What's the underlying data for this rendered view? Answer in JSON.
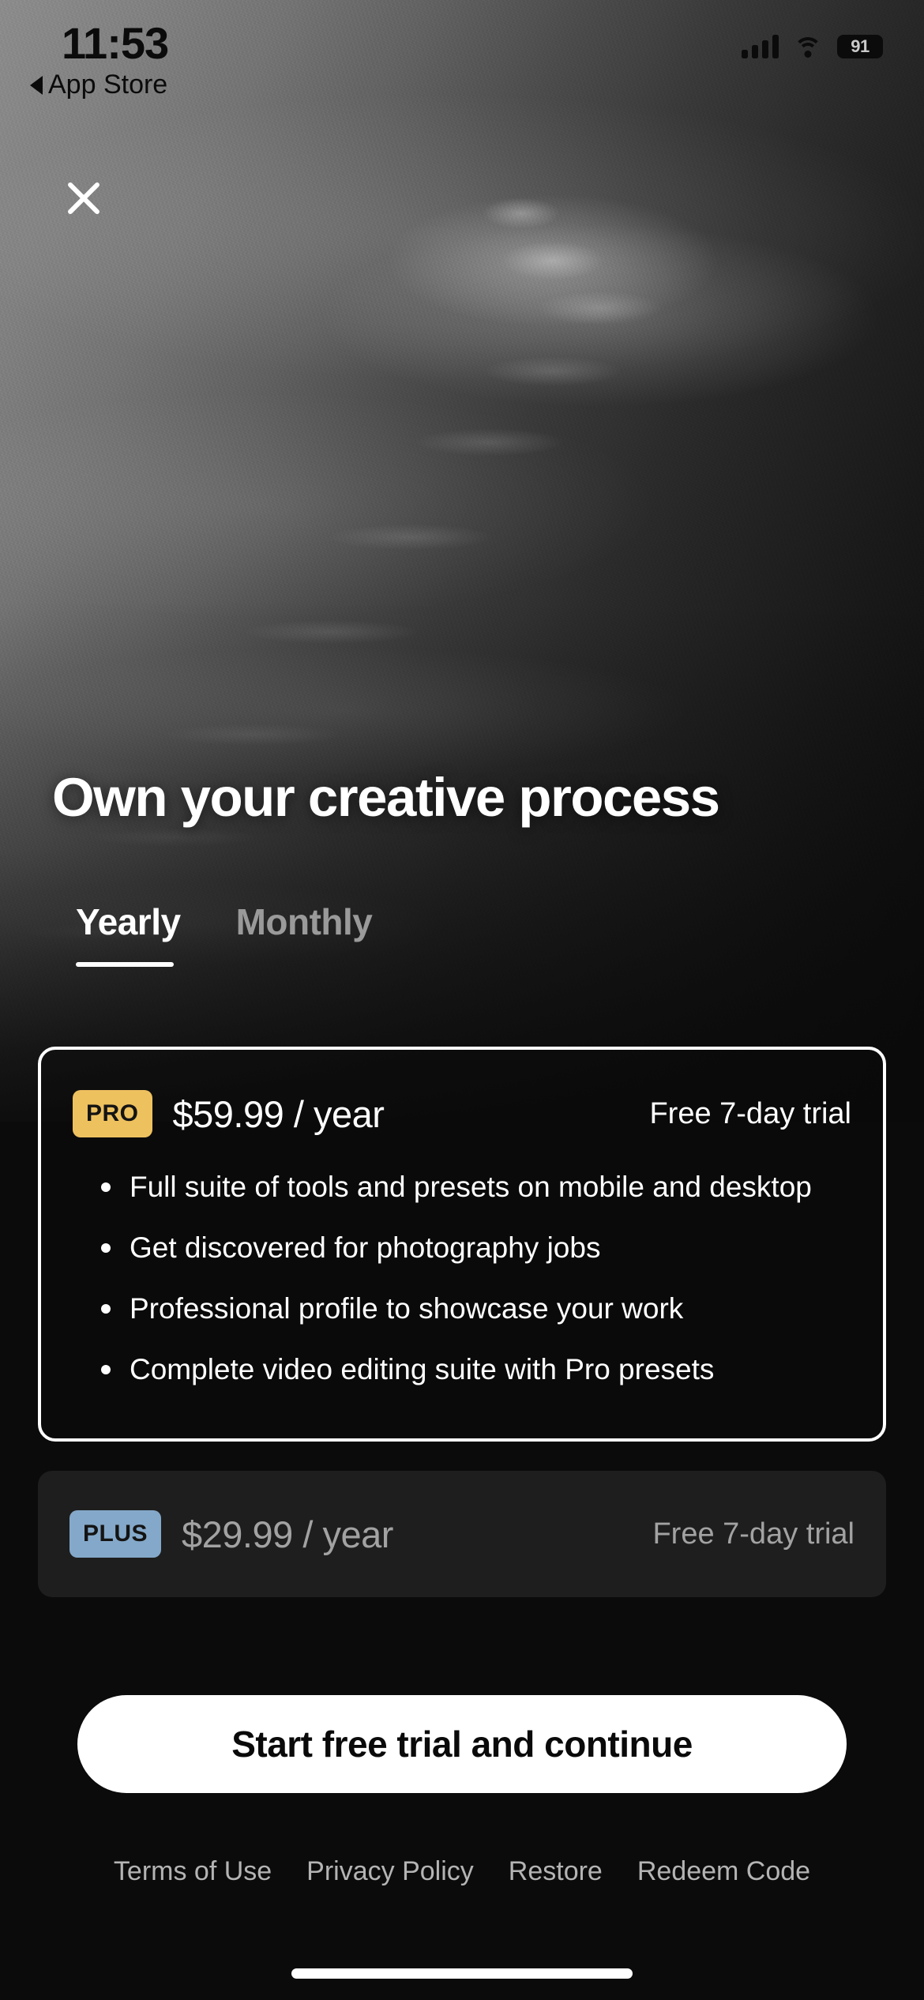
{
  "status_bar": {
    "time": "11:53",
    "back_label": "App Store",
    "battery_level": "91",
    "icons": {
      "back_caret": "back-caret-icon",
      "cellular": "cellular-signal-icon",
      "wifi": "wifi-icon",
      "battery": "battery-icon"
    }
  },
  "close_button": {
    "icon": "close-icon"
  },
  "headline": "Own your creative process",
  "billing_tabs": [
    {
      "label": "Yearly",
      "active": true
    },
    {
      "label": "Monthly",
      "active": false
    }
  ],
  "plans": {
    "pro": {
      "badge": "PRO",
      "badge_color": "#eec15f",
      "price": "$59.99 / year",
      "trial": "Free 7-day trial",
      "selected": true,
      "features": [
        "Full suite of tools and presets on mobile and desktop",
        "Get discovered for photography jobs",
        "Professional profile to showcase your work",
        "Complete video editing suite with Pro presets"
      ]
    },
    "plus": {
      "badge": "PLUS",
      "badge_color": "#84a8c9",
      "price": "$29.99 / year",
      "trial": "Free 7-day trial",
      "selected": false
    }
  },
  "cta": {
    "label": "Start free trial and continue"
  },
  "footer_links": [
    {
      "label": "Terms of Use"
    },
    {
      "label": "Privacy Policy"
    },
    {
      "label": "Restore"
    },
    {
      "label": "Redeem Code"
    }
  ],
  "theme": {
    "background": "#0b0b0b",
    "accent_pro": "#eec15f",
    "accent_plus": "#84a8c9",
    "text_primary": "#ffffff",
    "text_muted": "#a2a2a2"
  }
}
